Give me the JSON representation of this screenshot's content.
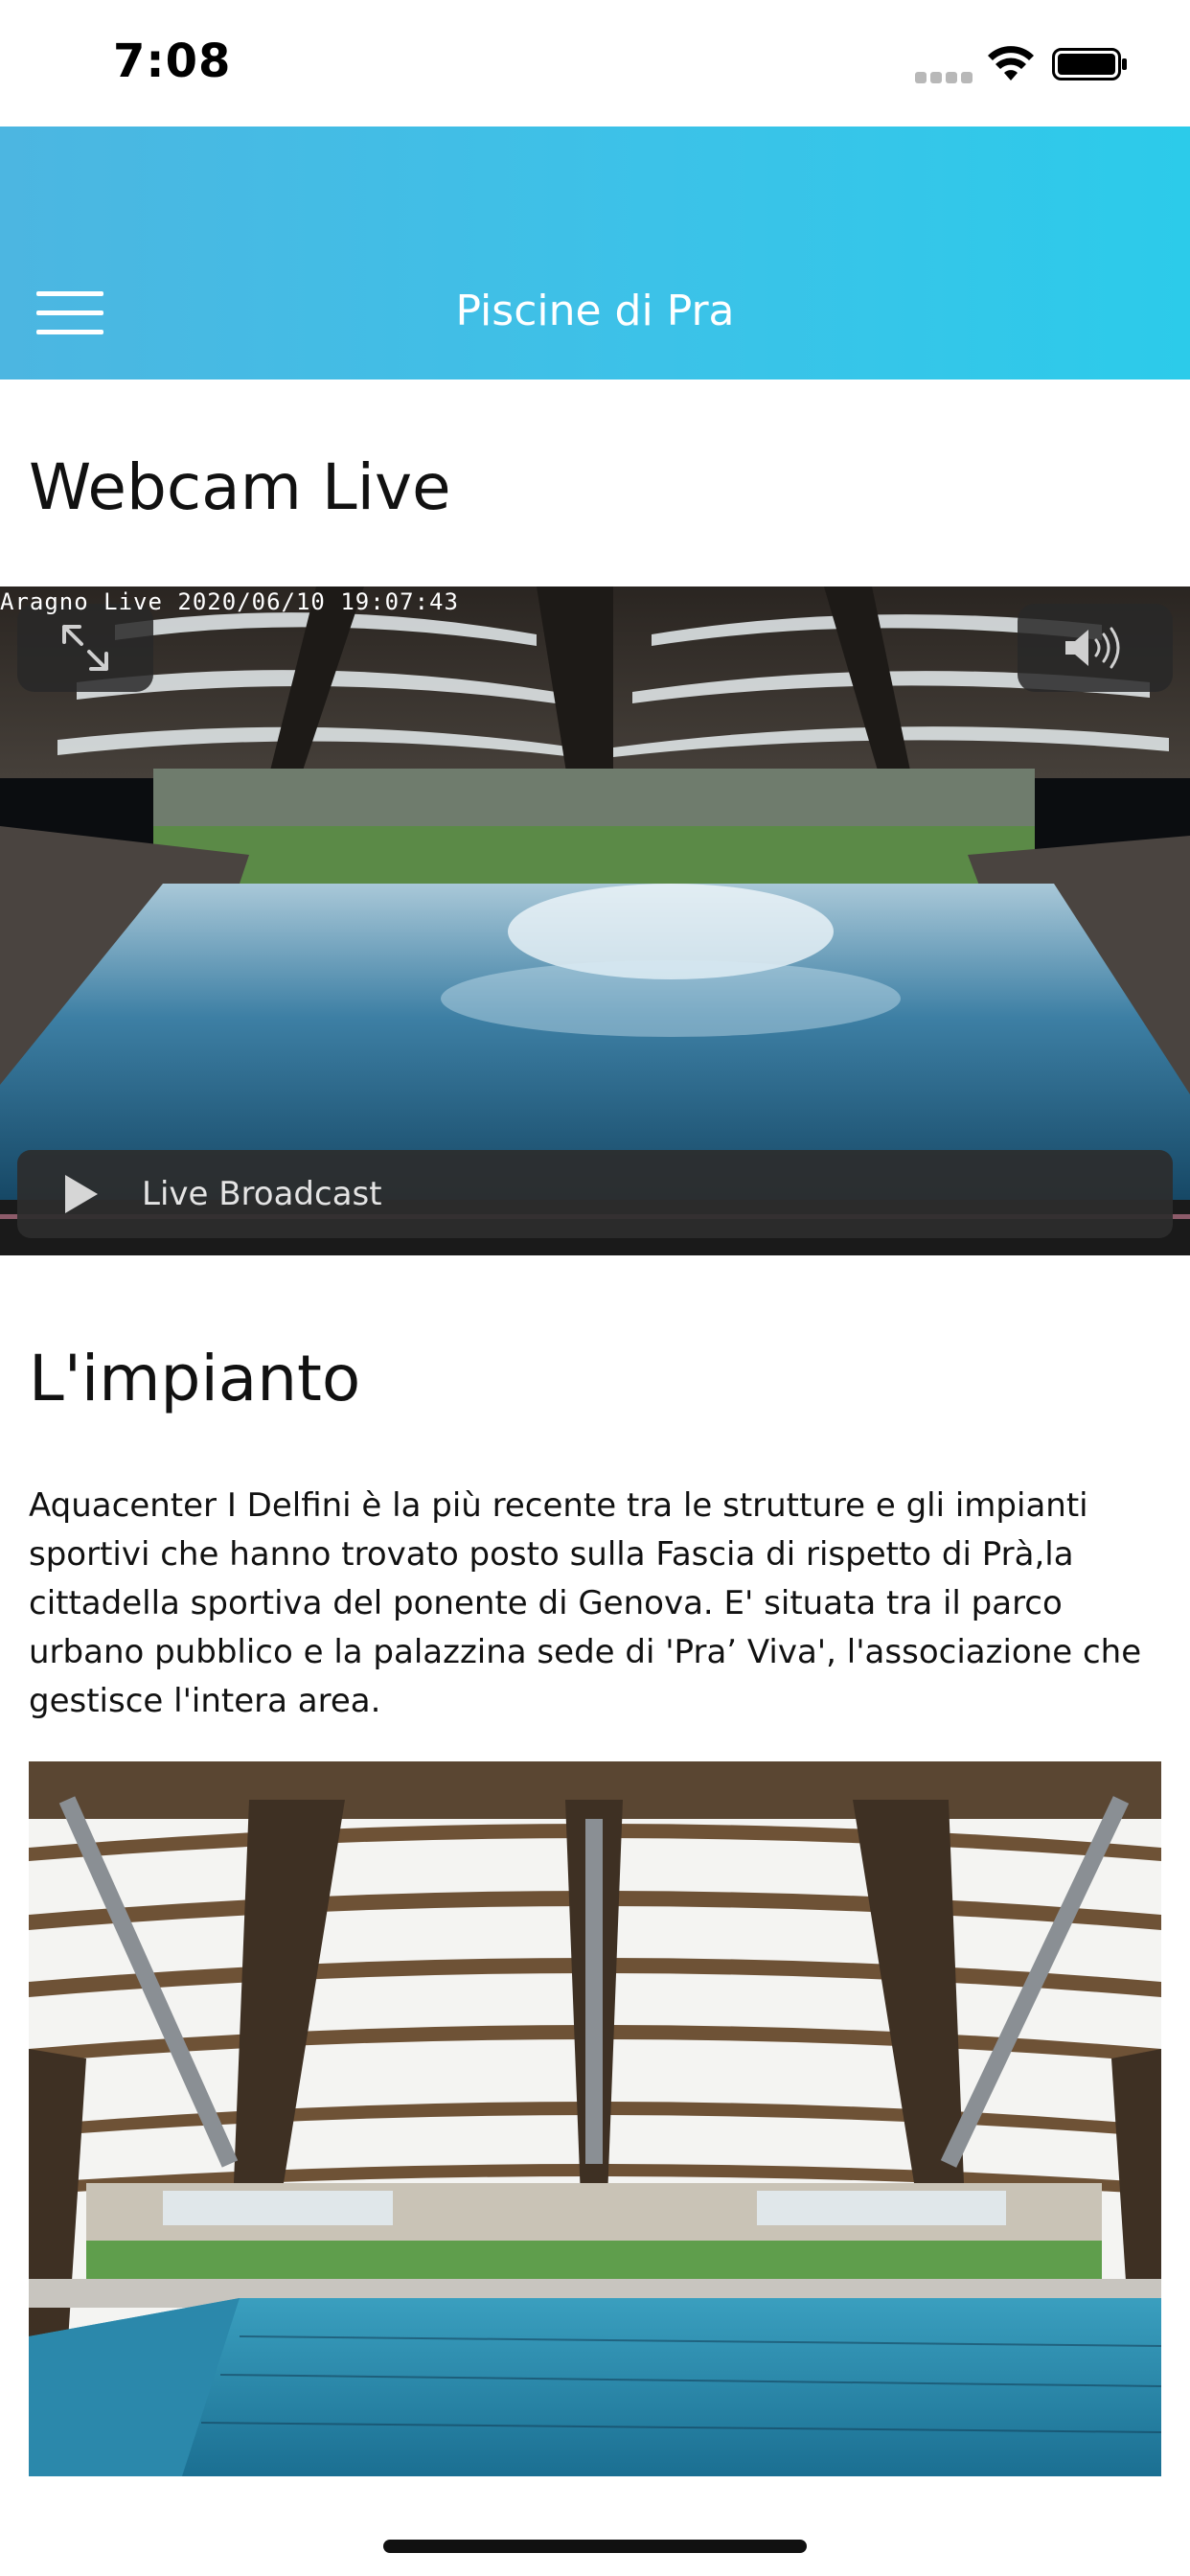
{
  "status_bar": {
    "time": "7:08",
    "icons": [
      "signal-icon",
      "wifi-icon",
      "battery-icon"
    ]
  },
  "header": {
    "menu_icon": "hamburger-menu-icon",
    "title": "Piscine di Pra",
    "gradient_start": "#4cb6e1",
    "gradient_end": "#2ccbea"
  },
  "webcam": {
    "title": "Webcam Live",
    "timestamp": "Aragno Live 2020/06/10 19:07:43",
    "fullscreen_icon": "fullscreen-expand-icon",
    "volume_icon": "volume-icon",
    "play_icon": "play-icon",
    "live_label": "Live Broadcast"
  },
  "facility": {
    "title": "L'impianto",
    "description": "Aquacenter I Delfini è la più recente tra le strutture e gli impianti sportivi che hanno trovato posto sulla Fascia di rispetto di Prà,la cittadella sportiva del ponente di Genova. E' situata tra il parco urbano pubblico e la palazzina sede di 'Pra’ Viva', l'associazione che gestisce l'intera area."
  }
}
